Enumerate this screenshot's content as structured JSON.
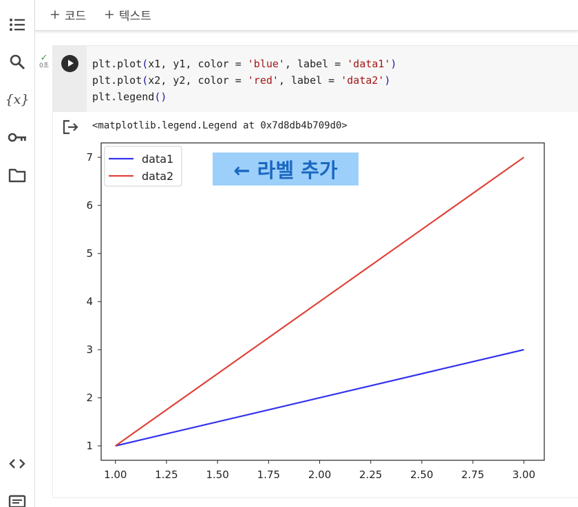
{
  "toolbar": {
    "add_code_label": "코드",
    "add_text_label": "텍스트",
    "plus": "+"
  },
  "sidebar": {
    "variables_label": "{x}"
  },
  "cell": {
    "status_icon": "check-icon",
    "exec_time": "0초",
    "code_lines": [
      "plt.plot(x1, y1, color = 'blue', label = 'data1')",
      "plt.plot(x2, y2, color = 'red', label = 'data2')",
      "plt.legend()"
    ],
    "output_text": "<matplotlib.legend.Legend at 0x7d8db4b709d0>"
  },
  "annotation": {
    "text": "← 라벨 추가",
    "background": "#9ccffa",
    "color": "#1a67c0"
  },
  "chart_data": {
    "type": "line",
    "title": "",
    "xlabel": "",
    "ylabel": "",
    "xlim": [
      0.93,
      3.1
    ],
    "ylim": [
      0.7,
      7.3
    ],
    "xticks": [
      "1.00",
      "1.25",
      "1.50",
      "1.75",
      "2.00",
      "2.25",
      "2.50",
      "2.75",
      "3.00"
    ],
    "yticks": [
      "1",
      "2",
      "3",
      "4",
      "5",
      "6",
      "7"
    ],
    "grid": false,
    "legend_position": "top-left",
    "series": [
      {
        "name": "data1",
        "color": "#3333ee",
        "x": [
          1,
          3
        ],
        "y": [
          1,
          3
        ]
      },
      {
        "name": "data2",
        "color": "#e0423a",
        "x": [
          1,
          3
        ],
        "y": [
          1,
          7
        ]
      }
    ]
  }
}
